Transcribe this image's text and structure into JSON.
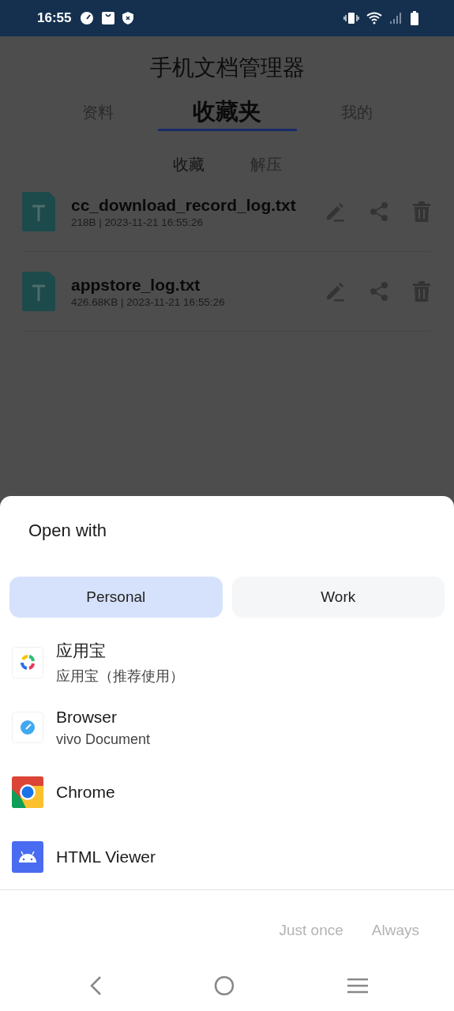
{
  "status_bar": {
    "time": "16:55"
  },
  "app": {
    "title": "手机文档管理器",
    "tabs": [
      {
        "label": "资料",
        "selected": false
      },
      {
        "label": "收藏夹",
        "selected": true
      },
      {
        "label": "我的",
        "selected": false
      }
    ],
    "subtabs": [
      {
        "label": "收藏",
        "selected": true
      },
      {
        "label": "解压",
        "selected": false
      }
    ],
    "files": [
      {
        "name": "cc_download_record_log.txt",
        "meta": "218B | 2023-11-21 16:55:26"
      },
      {
        "name": "appstore_log.txt",
        "meta": "426.68KB | 2023-11-21 16:55:26"
      }
    ]
  },
  "sheet": {
    "title": "Open with",
    "profiles": [
      {
        "label": "Personal",
        "selected": true
      },
      {
        "label": "Work",
        "selected": false
      }
    ],
    "apps": [
      {
        "kind": "appstore",
        "name": "应用宝",
        "subtitle": "应用宝（推荐使用）"
      },
      {
        "kind": "browser",
        "name": "Browser",
        "subtitle": "vivo Document"
      },
      {
        "kind": "chrome",
        "name": "Chrome"
      },
      {
        "kind": "android",
        "name": "HTML Viewer"
      }
    ],
    "buttons": [
      {
        "label": "Just once",
        "disabled": true
      },
      {
        "label": "Always",
        "disabled": true
      }
    ]
  }
}
